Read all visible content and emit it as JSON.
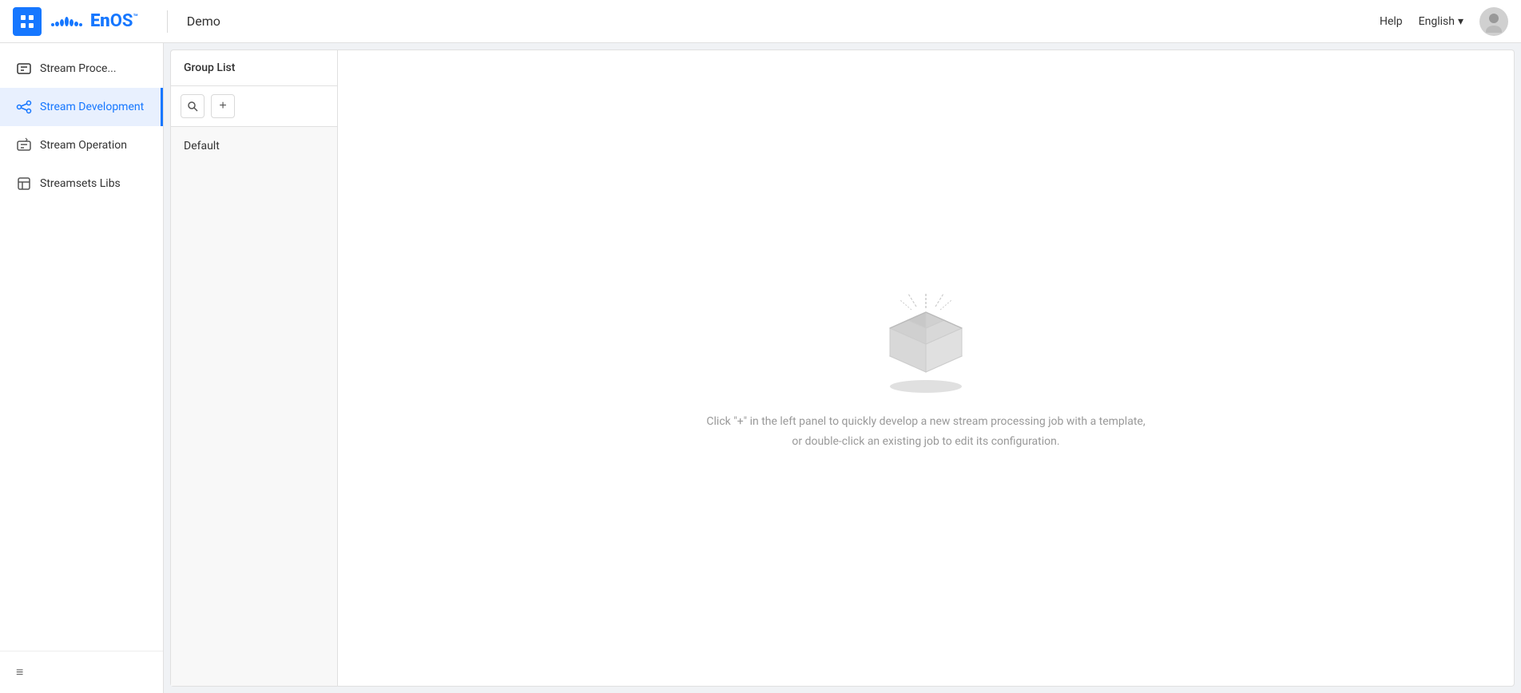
{
  "header": {
    "app_title": "Demo",
    "help_label": "Help",
    "lang_label": "English",
    "lang_arrow": "▾"
  },
  "sidebar": {
    "section_title": "Stream Proce...",
    "items": [
      {
        "id": "stream-development",
        "label": "Stream Development",
        "active": true
      },
      {
        "id": "stream-operation",
        "label": "Stream Operation",
        "active": false
      },
      {
        "id": "streamsets-libs",
        "label": "Streamsets Libs",
        "active": false
      }
    ],
    "collapse_label": "≡"
  },
  "group_list": {
    "header": "Group List",
    "search_label": "🔍",
    "add_label": "+",
    "items": [
      {
        "id": "default",
        "label": "Default",
        "selected": false
      }
    ]
  },
  "empty_state": {
    "message": "Click \"+\" in the left panel to quickly develop a new stream processing job with a template, or double-click an existing job to edit its configuration."
  }
}
